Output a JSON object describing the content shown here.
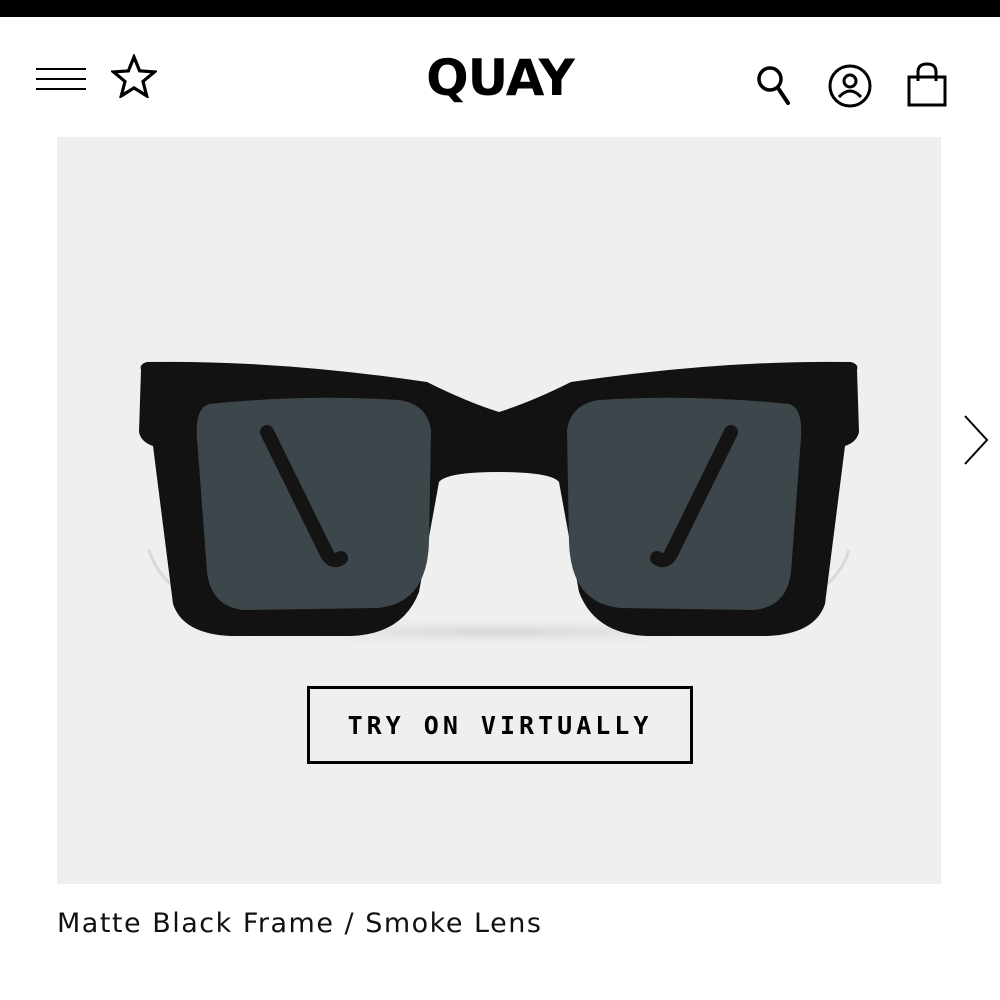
{
  "header": {
    "brand": "QUAY",
    "icons": {
      "menu": "hamburger-menu-icon",
      "wishlist": "star-icon",
      "search": "search-icon",
      "account": "user-account-icon",
      "cart": "shopping-bag-icon"
    }
  },
  "product": {
    "image": "matte black sunglasses with smoke lens",
    "try_on_label": "TRY ON VIRTUALLY",
    "next_icon": "chevron-right-icon",
    "variant": "Matte Black Frame / Smoke Lens"
  },
  "colors": {
    "background": "#ffffff",
    "panel": "#efefef",
    "text": "#000000"
  }
}
